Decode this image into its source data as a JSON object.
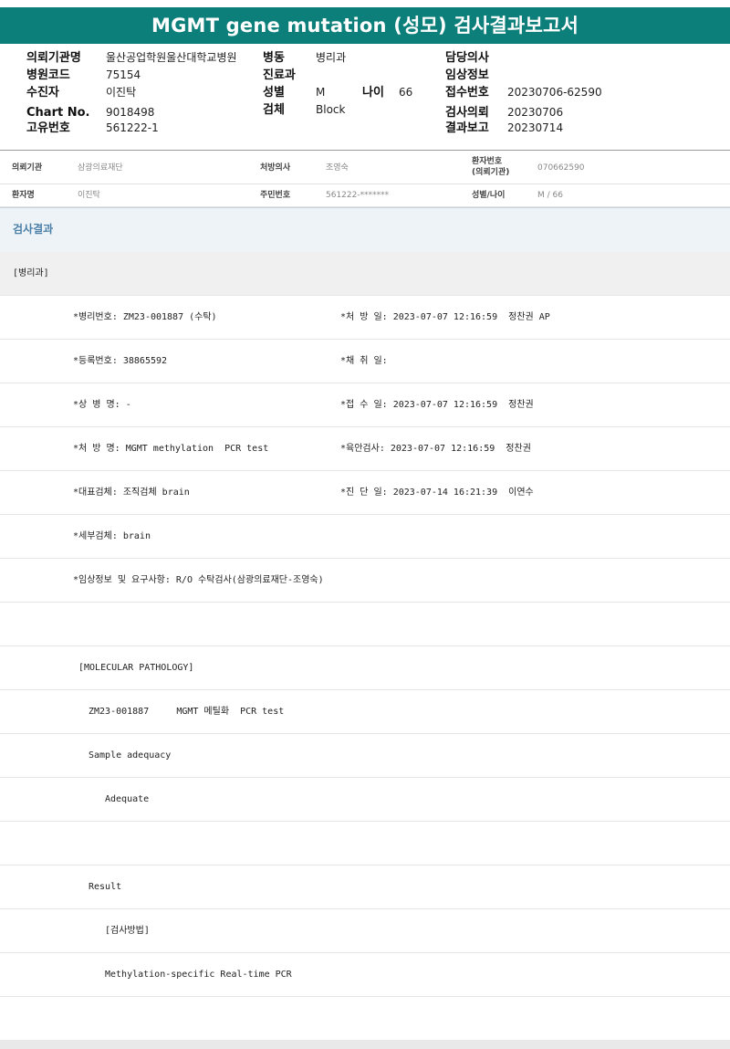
{
  "title": "MGMT gene mutation (성모) 검사결과보고서",
  "header": {
    "col1": [
      {
        "label": "의뢰기관명",
        "value": "울산공업학원울산대학교병원"
      },
      {
        "label": "병원코드",
        "value": "75154"
      },
      {
        "label": "수진자",
        "value": "이진탁"
      },
      {
        "label": "Chart No.",
        "value": "9018498"
      },
      {
        "label": "고유번호",
        "value": "561222-1"
      }
    ],
    "col2": [
      {
        "label": "병동",
        "value": "병리과"
      },
      {
        "label": "진료과",
        "value": ""
      },
      {
        "label": "성별",
        "value": "M",
        "extra_label": "나이",
        "extra_value": "66"
      },
      {
        "label": "검체",
        "value": "Block"
      }
    ],
    "col3": [
      {
        "label": "담당의사",
        "value": ""
      },
      {
        "label": "임상정보",
        "value": ""
      },
      {
        "label": "접수번호",
        "value": "20230706-62590"
      },
      {
        "label": "검사의뢰",
        "value": "20230706"
      },
      {
        "label": "결과보고",
        "value": "20230714"
      }
    ]
  },
  "info": {
    "row1": [
      {
        "label": "의뢰기관",
        "value": "삼광의료재단"
      },
      {
        "label": "처방의사",
        "value": "조영숙"
      },
      {
        "label_line1": "환자번호",
        "label_line2": "(의뢰기관)",
        "value": "070662590"
      }
    ],
    "row2": [
      {
        "label": "환자명",
        "value": "이진탁"
      },
      {
        "label": "주민번호",
        "value": "561222-*******"
      },
      {
        "label": "성별/나이",
        "value": "M / 66"
      }
    ]
  },
  "result_heading": "검사결과",
  "rows": [
    {
      "c1": "[병리과]"
    },
    {
      "c1": "*병리번호: ZM23-001887 (수탁)",
      "c2": "*처 방 일: 2023-07-07 12:16:59  정찬권 AP"
    },
    {
      "c1": "*등록번호: 38865592",
      "c2": "*채 취 일:"
    },
    {
      "c1": "*상 병 명: -",
      "c2": "*접 수 일: 2023-07-07 12:16:59  정찬권"
    },
    {
      "c1": "*처 방 명: MGMT methylation  PCR test",
      "c2": "*육안검사: 2023-07-07 12:16:59  정찬권"
    },
    {
      "c1": "*대표검체: 조직검체 brain",
      "c2": "*진 단 일: 2023-07-14 16:21:39  이연수"
    },
    {
      "c1": "*세부검체: brain"
    },
    {
      "c1": "*임상정보 및 요구사항: R/O 수탁검사(삼광의료재단-조영숙)"
    },
    {
      "c1": ""
    },
    {
      "c1": "[MOLECULAR PATHOLOGY]"
    },
    {
      "c1": "ZM23-001887     MGMT 메틸화  PCR test"
    },
    {
      "c1": "Sample adequacy"
    },
    {
      "c1": "Adequate"
    },
    {
      "c1": ""
    },
    {
      "c1": "Result"
    },
    {
      "c1": "[검사방법]"
    },
    {
      "c1": "Methylation-specific Real-time PCR"
    },
    {
      "c1": ""
    }
  ]
}
